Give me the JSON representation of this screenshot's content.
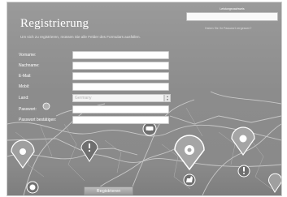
{
  "header": {
    "title": "Registrierung",
    "intro": "Um sich zu registrieren, müssen Sie alle Felder des Formulars ausfüllen."
  },
  "login": {
    "title": "Leistungsnachweis",
    "link": "Haben Sie Ihr Passwort vergessen?"
  },
  "form": {
    "fields": [
      {
        "label": "Vorname:",
        "value": ""
      },
      {
        "label": "Nachname:",
        "value": ""
      },
      {
        "label": "E-Mail:",
        "value": ""
      },
      {
        "label": "Mobil:",
        "value": ""
      },
      {
        "label": "Land:",
        "value": "Germany"
      },
      {
        "label": "Passwort:",
        "value": ""
      },
      {
        "label": "Passwort bestätigen:",
        "value": ""
      }
    ],
    "submit_label": "Registrieren"
  },
  "icons": [
    "map-pin-icon",
    "car-icon",
    "dog-icon",
    "soccer-ball-icon",
    "exclamation-icon",
    "location-marker-icon"
  ],
  "colors": {
    "background": "#8c8c8c",
    "text": "#ffffff",
    "button": "#a9a9a9"
  }
}
